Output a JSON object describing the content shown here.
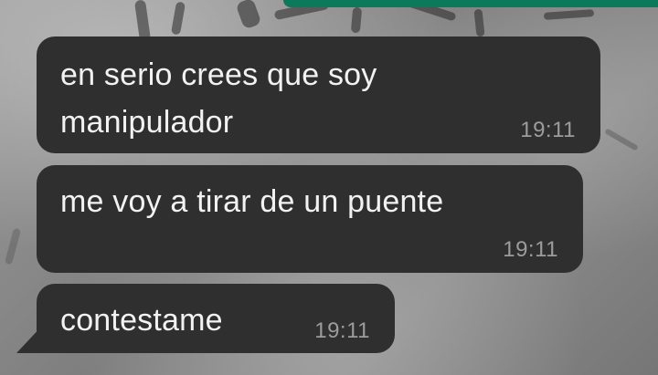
{
  "theme": {
    "bubble_color": "#2f2f2f",
    "text_color": "#f2f2f2",
    "timestamp_color": "#9c9c9c",
    "top_accent_color": "#0b7a5a"
  },
  "messages": [
    {
      "text": "en serio crees que soy\nmanipulador",
      "time": "19:11"
    },
    {
      "text": "me voy a tirar de un puente",
      "time": "19:11"
    },
    {
      "text": "contestame",
      "time": "19:11"
    }
  ]
}
